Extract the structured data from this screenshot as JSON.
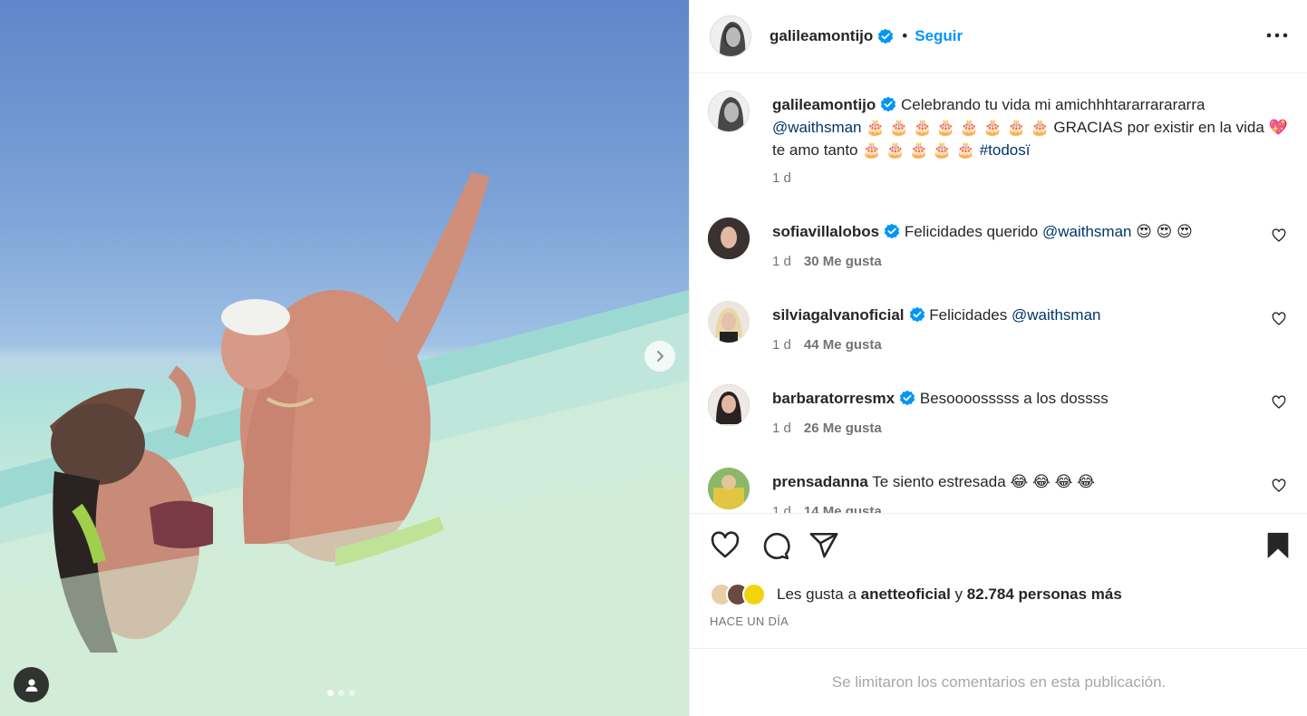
{
  "post": {
    "author": "galileamontijo",
    "follow_label": "Seguir",
    "bullet": "•",
    "caption": {
      "text_1": "Celebrando tu vida mi amichhhtararrarararra",
      "mention": "@waithsman",
      "cakes_1": "🎂 🎂 🎂 🎂 🎂 🎂 🎂 🎂",
      "text_2": " GRACIAS por existir en la vida ",
      "heart": "💖",
      "text_3": "te amo tanto ",
      "cakes_2": "🎂 🎂 🎂 🎂 🎂",
      "hashtag": " #todosï",
      "time": "1 d"
    },
    "image": {
      "carousel_count": 3,
      "carousel_active": 1
    }
  },
  "comments": [
    {
      "user": "sofiavillalobos",
      "verified": true,
      "text": "Felicidades querido ",
      "mention": "@waithsman",
      "emoji": " 😍 😍 😍",
      "time": "1 d",
      "likes": "30 Me gusta"
    },
    {
      "user": "silviagalvanoficial",
      "verified": true,
      "text": "Felicidades ",
      "mention": "@waithsman",
      "emoji": "",
      "time": "1 d",
      "likes": "44 Me gusta"
    },
    {
      "user": "barbaratorresmx",
      "verified": true,
      "text": "Besoooosssss a los dossss",
      "mention": "",
      "emoji": "",
      "time": "1 d",
      "likes": "26 Me gusta"
    },
    {
      "user": "prensadanna",
      "verified": false,
      "text": "Te siento estresada ",
      "mention": "",
      "emoji": "😂 😂 😂 😂",
      "time": "1 d",
      "likes": "14 Me gusta"
    }
  ],
  "likes": {
    "prefix": "Les gusta a ",
    "user": "anetteoficial",
    "middle": " y ",
    "count": "82.784 personas más"
  },
  "time_ago": "HACE UN DÍA",
  "limited_notice": "Se limitaron los comentarios en esta publicación.",
  "colors": {
    "link_blue": "#0095f6",
    "mention": "#00376b",
    "verified": "#0095f6",
    "muted": "#737373"
  },
  "icons": [
    "heart-icon",
    "comment-icon",
    "share-icon",
    "bookmark-icon",
    "more-icon",
    "verified-icon",
    "chevron-right-icon",
    "user-icon"
  ]
}
